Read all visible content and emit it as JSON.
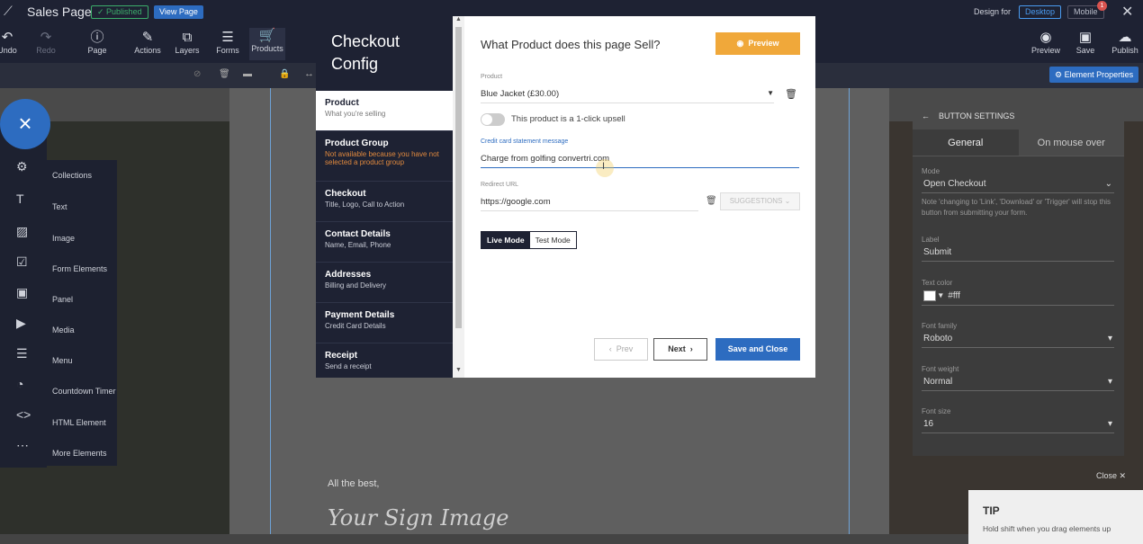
{
  "topbar": {
    "page_name": "Sales Page",
    "published_label": "Published",
    "view_page_label": "View Page",
    "tools": [
      {
        "label": "Undo",
        "icon": "undo-icon"
      },
      {
        "label": "Redo",
        "icon": "redo-icon"
      },
      {
        "label": "Page",
        "icon": "info-icon"
      },
      {
        "label": "Actions",
        "icon": "wand-icon"
      },
      {
        "label": "Layers",
        "icon": "layers-icon"
      },
      {
        "label": "Forms",
        "icon": "forms-icon"
      },
      {
        "label": "Products",
        "icon": "cart-icon"
      }
    ],
    "design_for_label": "Design for",
    "desktop_label": "Desktop",
    "mobile_label": "Mobile",
    "mobile_badge": "1",
    "right_tools": [
      {
        "label": "Preview",
        "icon": "eye-icon"
      },
      {
        "label": "Save",
        "icon": "save-icon"
      },
      {
        "label": "Publish",
        "icon": "cloud-upload-icon"
      }
    ]
  },
  "element_properties_label": "Element Properties",
  "elements_panel": {
    "categories": [
      "Collections",
      "Text",
      "Image",
      "Form Elements",
      "Panel",
      "Media",
      "Menu",
      "Countdown Timer",
      "HTML Element",
      "More Elements"
    ]
  },
  "button_settings": {
    "title": "BUTTON SETTINGS",
    "tabs": [
      "General",
      "On mouse over"
    ],
    "mode_label": "Mode",
    "mode_value": "Open Checkout",
    "mode_note": "Note 'changing to 'Link', 'Download' or 'Trigger' will stop this button from submitting your form.",
    "label_label": "Label",
    "label_value": "Submit",
    "text_color_label": "Text color",
    "text_color_value": "#fff",
    "font_family_label": "Font family",
    "font_family_value": "Roboto",
    "font_weight_label": "Font weight",
    "font_weight_value": "Normal",
    "font_size_label": "Font size",
    "font_size_value": "16"
  },
  "close_label": "Close",
  "tip": {
    "title": "TIP",
    "text": "Hold shift when you drag elements up"
  },
  "page_content": {
    "sign_off": "All the best,",
    "signature": "Your Sign Image"
  },
  "modal": {
    "title": "Checkout Config",
    "steps": [
      {
        "title": "Product",
        "subtitle": "What you're selling"
      },
      {
        "title": "Product Group",
        "subtitle": "Not available because you have not selected a product group"
      },
      {
        "title": "Checkout",
        "subtitle": "Title, Logo, Call to Action"
      },
      {
        "title": "Contact Details",
        "subtitle": "Name, Email, Phone"
      },
      {
        "title": "Addresses",
        "subtitle": "Billing and Delivery"
      },
      {
        "title": "Payment Details",
        "subtitle": "Credit Card Details"
      },
      {
        "title": "Receipt",
        "subtitle": "Send a receipt"
      }
    ],
    "heading": "What Product does this page Sell?",
    "preview_label": "Preview",
    "product_label": "Product",
    "product_value": "Blue Jacket (£30.00)",
    "upsell_label": "This product is a 1-click upsell",
    "cc_message_label": "Credit card statement message",
    "cc_message_value": "Charge from golfing convertri.com",
    "redirect_label": "Redirect URL",
    "redirect_value": "https://google.com",
    "suggestions_label": "SUGGESTIONS",
    "live_mode_label": "Live Mode",
    "test_mode_label": "Test Mode",
    "prev_label": "Prev",
    "next_label": "Next",
    "save_close_label": "Save and Close"
  },
  "colors": {
    "topbar": "#1e2233",
    "accent_blue": "#2d6cc0",
    "preview_orange": "#f0a83a",
    "published_green": "#3cae6b"
  }
}
